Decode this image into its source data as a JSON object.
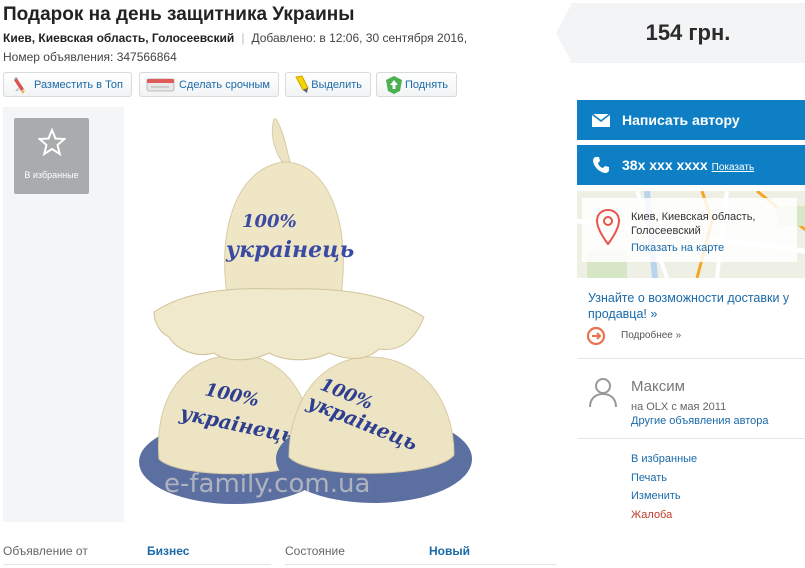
{
  "listing": {
    "title": "Подарок на день защитника Украины",
    "location": "Киев, Киевская область, Голосеевский",
    "added": "Добавлено: в 12:06, 30 сентября 2016,",
    "ad_number": "Номер объявления: 347566864"
  },
  "price": "154 грн.",
  "promo_buttons": [
    {
      "label": "Разместить в Топ",
      "icon": "rocket-icon"
    },
    {
      "label": "Сделать срочным",
      "icon": "urgent-icon"
    },
    {
      "label": "Выделить",
      "icon": "highlighter-icon"
    },
    {
      "label": "Поднять",
      "icon": "raise-icon"
    }
  ],
  "gallery": {
    "favorite_label": "В избранные",
    "hat_text": [
      "100%",
      "украінець"
    ],
    "slipper_text": [
      "100%",
      "украінець"
    ],
    "watermark": "e-family.com.ua"
  },
  "contact": {
    "write_label": "Написать автору",
    "phone": "38х ххх хххх",
    "show_label": "Показать"
  },
  "map": {
    "address_line1": "Киев, Киевская область,",
    "address_line2": "Голосеевский",
    "show_on_map": "Показать на карте"
  },
  "delivery": {
    "text": "Узнайте о возможности доставки у продавца! »",
    "more": "Подробнее »"
  },
  "seller": {
    "name": "Максим",
    "since": "на OLX с мая 2011",
    "other_ads": "Другие объявления автора"
  },
  "actions": {
    "favorite": "В избранные",
    "print": "Печать",
    "edit": "Изменить",
    "complaint": "Жалоба"
  },
  "params": [
    {
      "key": "Объявление от",
      "value": "Бизнес"
    },
    {
      "key": "Состояние",
      "value": "Новый"
    }
  ],
  "colors": {
    "accent": "#0e7fc4",
    "link": "#1a6aa9",
    "complaint": "#c0392b",
    "price_bg": "#f2f4f5"
  }
}
